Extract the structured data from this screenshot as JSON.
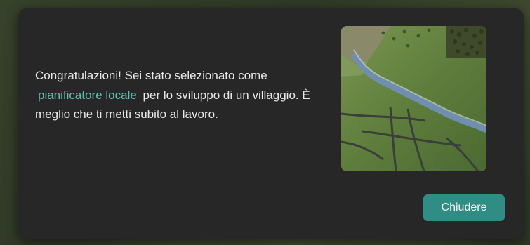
{
  "dialog": {
    "message": {
      "before": "Congratulazioni! Sei stato selezionato come",
      "highlight": "pianificatore locale",
      "after": "per lo sviluppo di un villaggio. È meglio che ti metti subito al lavoro."
    },
    "close_label": "Chiudere",
    "accent_color": "#5ec2b0",
    "button_color": "#2f8d84",
    "illustration_icon": "village-terrain-illustration"
  }
}
